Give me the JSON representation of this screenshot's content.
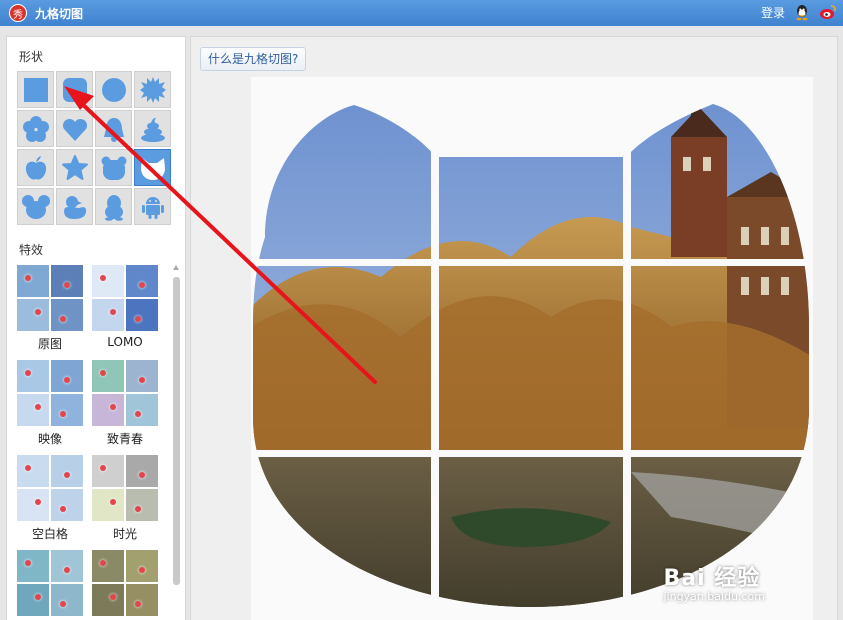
{
  "window": {
    "title": "九格切图",
    "logo_char": "秀"
  },
  "header": {
    "login_label": "登录",
    "icons": [
      "qq-icon",
      "weibo-icon"
    ]
  },
  "sidebar": {
    "shape_label": "形状",
    "shapes": [
      "square",
      "rounded-square",
      "circle",
      "starburst",
      "flower",
      "heart",
      "bell",
      "poop",
      "apple",
      "star",
      "bear",
      "cat",
      "mouse",
      "duck",
      "penguin",
      "android"
    ],
    "selected_shape": "cat",
    "effects_label": "特效",
    "effects": [
      "原图",
      "LOMO",
      "映像",
      "致青春",
      "空白格",
      "时光",
      "",
      ""
    ]
  },
  "main": {
    "help_button": "什么是九格切图?"
  },
  "watermark": {
    "main": "Bai 经验",
    "sub": "jingyan.baidu.com"
  },
  "colors": {
    "accent": "#5b9ce0",
    "titlebar": "#4a8dd6",
    "annotation_arrow": "#e8141b"
  }
}
